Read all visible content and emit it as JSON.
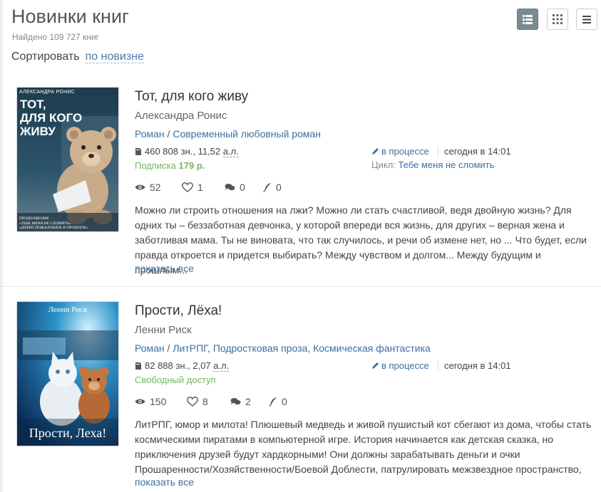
{
  "page": {
    "title": "Новинки книг",
    "found": "Найдено 109 727 книг",
    "sort_label": "Сортировать",
    "sort_value": "по новизне"
  },
  "view_buttons": [
    "list-view-icon",
    "grid-view-icon",
    "menu-icon"
  ],
  "books": [
    {
      "cover": {
        "author": "АЛЕКСАНДРА РОНИС",
        "title_lines": [
          "ТОТ,",
          "ДЛЯ КОГО",
          "ЖИВУ"
        ],
        "note_lines": [
          "ПРОДОЛЖЕНИЕ",
          "«ТЕБЕ МЕНЯ НЕ СЛОМИТЬ»",
          "«ДОБРО ПОЖАЛОВАТЬ В ПРОШЛОЕ»"
        ]
      },
      "title": "Тот, для кого живу",
      "author": "Александра Ронис",
      "genres": [
        "Роман",
        "Современный любовный роман"
      ],
      "size": "460 808 зн., 11,52",
      "size_unit": "а.л.",
      "price_label": "Подписка",
      "price_value": "179 р.",
      "status": "в процессе",
      "date": "сегодня в 14:01",
      "cycle_label": "Цикл:",
      "cycle_name": "Тебе меня не сломить",
      "views": "52",
      "likes": "1",
      "comments": "0",
      "rewards": "0",
      "description": "Можно ли строить отношения на лжи? Можно ли стать счастливой, ведя двойную жизнь? Для одних ты – беззаботная девчонка, у которой впереди вся жизнь, для других – верная жена и заботливая мама. Ты не виновата, что так случилось, и речи об измене нет, но ... Что будет, если правда откроется и придется выбирать? Между чувством и долгом... Между будущим и прошлым...",
      "show_all": "показать все"
    },
    {
      "cover": {
        "author": "Ленни Риск",
        "title": "Прости, Леха!"
      },
      "title": "Прости, Лёха!",
      "author": "Ленни Риск",
      "genres": [
        "Роман",
        "ЛитРПГ",
        "Подростковая проза",
        "Космическая фантастика"
      ],
      "size": "82 888 зн., 2,07",
      "size_unit": "а.л.",
      "price_label": "Свободный доступ",
      "status": "в процессе",
      "date": "сегодня в 14:01",
      "views": "150",
      "likes": "8",
      "comments": "2",
      "rewards": "0",
      "description": "ЛитРПГ, юмор и милота! Плюшевый медведь и живой пушистый кот сбегают из дома, чтобы стать космическими пиратами в компьютерной игре. История начинается как детская сказка, но приключения друзей будут хардкорными! Они должны зарабатывать деньги и очки Прошаренности/Хозяйственности/Боевой Доблести, патрулировать межзвездное пространство,",
      "show_all": "показать все"
    }
  ]
}
